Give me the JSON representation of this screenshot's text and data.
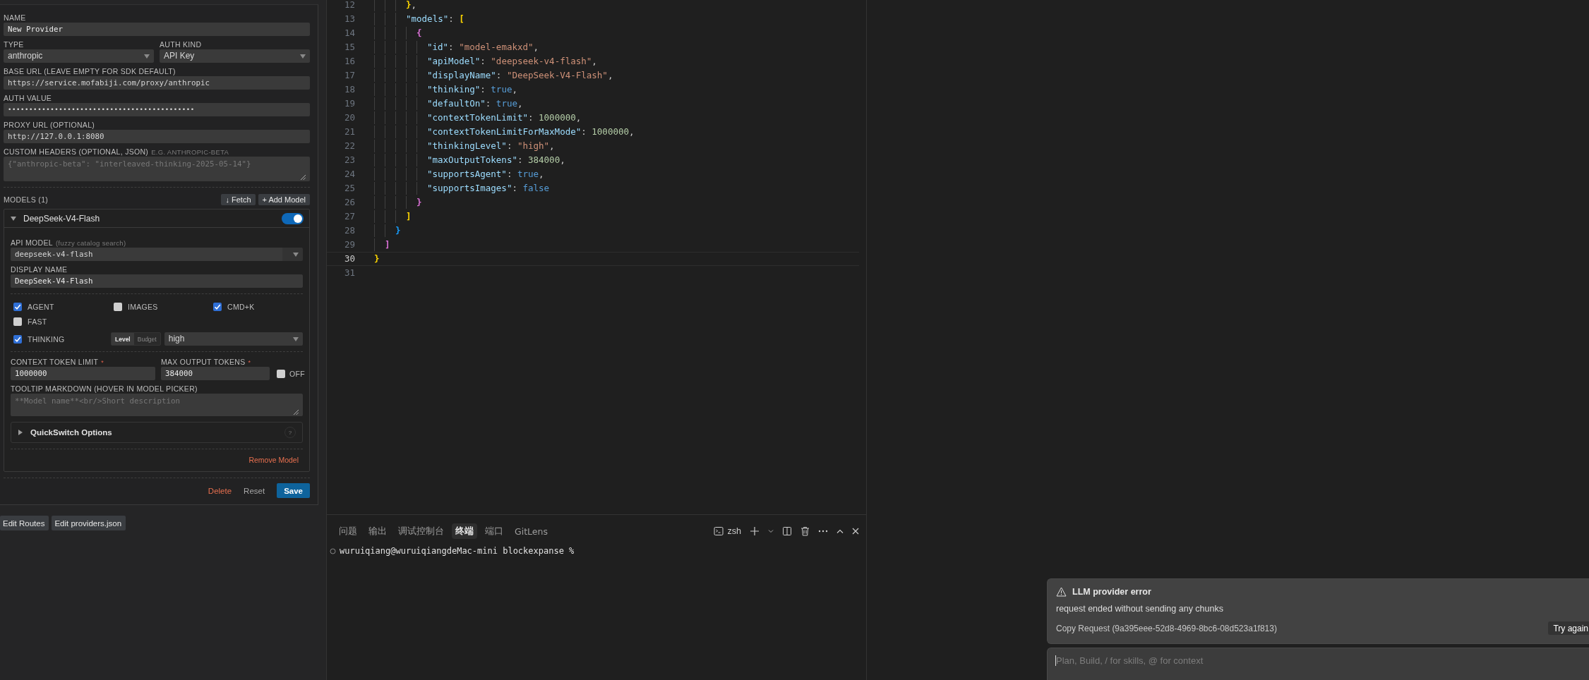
{
  "provider_form": {
    "name": {
      "label": "NAME",
      "value": "New Provider"
    },
    "type": {
      "label": "TYPE",
      "value": "anthropic"
    },
    "auth_kind": {
      "label": "AUTH KIND",
      "value": "API Key"
    },
    "base_url": {
      "label": "BASE URL (LEAVE EMPTY FOR SDK DEFAULT)",
      "value": "https://service.mofabiji.com/proxy/anthropic"
    },
    "auth_value": {
      "label": "AUTH VALUE",
      "value": "••••••••••••••••••••••••••••••••••••••••••••"
    },
    "proxy_url": {
      "label": "PROXY URL (OPTIONAL)",
      "value": "http://127.0.0.1:8080"
    },
    "custom_headers": {
      "label": "CUSTOM HEADERS (OPTIONAL, JSON)",
      "hint": "E.G. ANTHROPIC-BETA",
      "placeholder": "{\"anthropic-beta\": \"interleaved-thinking-2025-05-14\"}"
    },
    "models_heading": "MODELS (1)",
    "model_buttons": [
      "↓ Fetch",
      "+ Add Model"
    ],
    "models": [
      {
        "title": "DeepSeek-V4-Flash",
        "expanded": true,
        "on": true,
        "api_model": {
          "label": "API MODEL",
          "hint": "(fuzzy catalog search)",
          "value": "deepseek-v4-flash"
        },
        "display_name": {
          "label": "DISPLAY NAME",
          "value": "DeepSeek-V4-Flash"
        },
        "capabilities": [
          {
            "label": "AGENT",
            "checked": true
          },
          {
            "label": "IMAGES",
            "checked": false
          },
          {
            "label": "CMD+K",
            "checked": true
          },
          {
            "label": "FAST",
            "checked": false
          }
        ],
        "thinking": {
          "label": "THINKING",
          "checked": true,
          "modes": [
            {
              "label": "Level",
              "selected": true
            },
            {
              "label": "Budget",
              "selected": false
            }
          ],
          "value": "high"
        },
        "context_limit": {
          "label": "CONTEXT TOKEN LIMIT",
          "required_mark": "*",
          "value": "1000000"
        },
        "max_output": {
          "label": "MAX OUTPUT TOKENS",
          "required_mark": "*",
          "value": "384000"
        },
        "off": {
          "label": "OFF",
          "checked": false
        },
        "tooltip": {
          "label": "TOOLTIP MARKDOWN (HOVER IN MODEL PICKER)",
          "placeholder": "**Model name**<br/>Short description"
        },
        "quickswitch": {
          "label": "QuickSwitch Options",
          "expanded": false,
          "help": "?"
        },
        "remove": "Remove Model"
      }
    ],
    "actions": [
      {
        "label": "Delete",
        "kind": "danger"
      },
      {
        "label": "Reset",
        "kind": "plain"
      },
      {
        "label": "Save",
        "kind": "primary"
      }
    ]
  },
  "footer_buttons": [
    "Edit Routes",
    "Edit providers.json"
  ],
  "editor": {
    "lines": [
      {
        "number": "12",
        "selected": false,
        "tokens": [
          {
            "kind": "bracket",
            "color": "#ffd700",
            "text": "      }"
          },
          {
            "kind": "punct",
            "text": ","
          }
        ]
      },
      {
        "number": "13",
        "selected": false,
        "tokens": [
          {
            "kind": "key",
            "text": "      \"models\""
          },
          {
            "kind": "punct",
            "text": ": "
          },
          {
            "kind": "bracket",
            "color": "#ffd700",
            "text": "["
          }
        ]
      },
      {
        "number": "14",
        "selected": false,
        "tokens": [
          {
            "kind": "bracket",
            "color": "#da70d6",
            "text": "        {"
          }
        ]
      },
      {
        "number": "15",
        "selected": false,
        "tokens": [
          {
            "kind": "key",
            "text": "          \"id\""
          },
          {
            "kind": "punct",
            "text": ": "
          },
          {
            "kind": "string",
            "text": "\"model-emakxd\""
          },
          {
            "kind": "punct",
            "text": ","
          }
        ]
      },
      {
        "number": "16",
        "selected": false,
        "tokens": [
          {
            "kind": "key",
            "text": "          \"apiModel\""
          },
          {
            "kind": "punct",
            "text": ": "
          },
          {
            "kind": "string",
            "text": "\"deepseek-v4-flash\""
          },
          {
            "kind": "punct",
            "text": ","
          }
        ]
      },
      {
        "number": "17",
        "selected": false,
        "tokens": [
          {
            "kind": "key",
            "text": "          \"displayName\""
          },
          {
            "kind": "punct",
            "text": ": "
          },
          {
            "kind": "string",
            "text": "\"DeepSeek-V4-Flash\""
          },
          {
            "kind": "punct",
            "text": ","
          }
        ]
      },
      {
        "number": "18",
        "selected": false,
        "tokens": [
          {
            "kind": "key",
            "text": "          \"thinking\""
          },
          {
            "kind": "punct",
            "text": ": "
          },
          {
            "kind": "literal",
            "text": "true"
          },
          {
            "kind": "punct",
            "text": ","
          }
        ]
      },
      {
        "number": "19",
        "selected": false,
        "tokens": [
          {
            "kind": "key",
            "text": "          \"defaultOn\""
          },
          {
            "kind": "punct",
            "text": ": "
          },
          {
            "kind": "literal",
            "text": "true"
          },
          {
            "kind": "punct",
            "text": ","
          }
        ]
      },
      {
        "number": "20",
        "selected": false,
        "tokens": [
          {
            "kind": "key",
            "text": "          \"contextTokenLimit\""
          },
          {
            "kind": "punct",
            "text": ": "
          },
          {
            "kind": "number",
            "text": "1000000"
          },
          {
            "kind": "punct",
            "text": ","
          }
        ]
      },
      {
        "number": "21",
        "selected": false,
        "tokens": [
          {
            "kind": "key",
            "text": "          \"contextTokenLimitForMaxMode\""
          },
          {
            "kind": "punct",
            "text": ": "
          },
          {
            "kind": "number",
            "text": "1000000"
          },
          {
            "kind": "punct",
            "text": ","
          }
        ]
      },
      {
        "number": "22",
        "selected": false,
        "tokens": [
          {
            "kind": "key",
            "text": "          \"thinkingLevel\""
          },
          {
            "kind": "punct",
            "text": ": "
          },
          {
            "kind": "string",
            "text": "\"high\""
          },
          {
            "kind": "punct",
            "text": ","
          }
        ]
      },
      {
        "number": "23",
        "selected": false,
        "tokens": [
          {
            "kind": "key",
            "text": "          \"maxOutputTokens\""
          },
          {
            "kind": "punct",
            "text": ": "
          },
          {
            "kind": "number",
            "text": "384000"
          },
          {
            "kind": "punct",
            "text": ","
          }
        ]
      },
      {
        "number": "24",
        "selected": false,
        "tokens": [
          {
            "kind": "key",
            "text": "          \"supportsAgent\""
          },
          {
            "kind": "punct",
            "text": ": "
          },
          {
            "kind": "literal",
            "text": "true"
          },
          {
            "kind": "punct",
            "text": ","
          }
        ]
      },
      {
        "number": "25",
        "selected": false,
        "tokens": [
          {
            "kind": "key",
            "text": "          \"supportsImages\""
          },
          {
            "kind": "punct",
            "text": ": "
          },
          {
            "kind": "literal",
            "text": "false"
          }
        ]
      },
      {
        "number": "26",
        "selected": false,
        "tokens": [
          {
            "kind": "bracket",
            "color": "#da70d6",
            "text": "        }"
          }
        ]
      },
      {
        "number": "27",
        "selected": false,
        "tokens": [
          {
            "kind": "bracket",
            "color": "#ffd700",
            "text": "      ]"
          }
        ]
      },
      {
        "number": "28",
        "selected": false,
        "tokens": [
          {
            "kind": "bracket",
            "color": "#179fff",
            "text": "    }"
          }
        ]
      },
      {
        "number": "29",
        "selected": false,
        "tokens": [
          {
            "kind": "bracket",
            "color": "#da70d6",
            "text": "  ]"
          }
        ]
      },
      {
        "number": "30",
        "selected": true,
        "tokens": [
          {
            "kind": "bracket",
            "color": "#ffd700",
            "text": "}"
          }
        ]
      },
      {
        "number": "31",
        "selected": false
      }
    ]
  },
  "panel": {
    "tabs": [
      {
        "label": "问题",
        "selected": false
      },
      {
        "label": "输出",
        "selected": false
      },
      {
        "label": "调试控制台",
        "selected": false
      },
      {
        "label": "终端",
        "selected": true
      },
      {
        "label": "端口",
        "selected": false
      },
      {
        "label": "GitLens",
        "selected": false
      }
    ],
    "shell": "zsh",
    "terminal_lines": [
      "wuruiqiang@wuruiqiangdeMac-mini blockexpanse %"
    ]
  },
  "chat": {
    "error": {
      "title": "LLM provider error",
      "message": "request ended without sending any chunks",
      "request": "Copy Request (9a395eee-52d8-4969-8bc6-08d523a1f813)",
      "retry": "Try again"
    },
    "input": {
      "placeholder": "Plan, Build, / for skills, @ for context"
    }
  }
}
